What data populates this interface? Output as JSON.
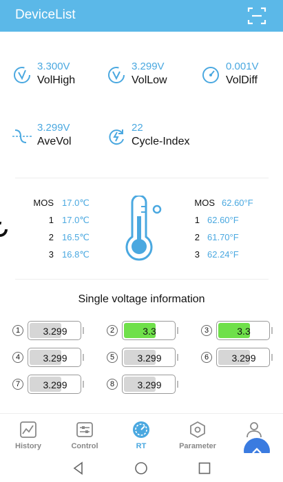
{
  "header": {
    "title": "DeviceList",
    "scan_icon": "scan-icon"
  },
  "stats": [
    {
      "value": "3.300V",
      "label": "VolHigh",
      "icon": "voltage-high-icon"
    },
    {
      "value": "3.299V",
      "label": "VolLow",
      "icon": "voltage-low-icon"
    },
    {
      "value": "0.001V",
      "label": "VolDiff",
      "icon": "gauge-icon"
    },
    {
      "value": "3.299V",
      "label": "AveVol",
      "icon": "average-voltage-icon"
    },
    {
      "value": "22",
      "label": "Cycle-Index",
      "icon": "cycle-icon"
    }
  ],
  "temps_c": [
    {
      "key": "MOS",
      "value": "17.0℃"
    },
    {
      "key": "1",
      "value": "17.0℃"
    },
    {
      "key": "2",
      "value": "16.5℃"
    },
    {
      "key": "3",
      "value": "16.8℃"
    }
  ],
  "temps_f": [
    {
      "key": "MOS",
      "value": "62.60°F"
    },
    {
      "key": "1",
      "value": "62.60°F"
    },
    {
      "key": "2",
      "value": "61.70°F"
    },
    {
      "key": "3",
      "value": "62.24°F"
    }
  ],
  "single_voltage": {
    "title": "Single voltage information",
    "cells": [
      {
        "num": "1",
        "value": "3.299",
        "level": 0.6,
        "highlight": false
      },
      {
        "num": "2",
        "value": "3.3",
        "level": 0.6,
        "highlight": true
      },
      {
        "num": "3",
        "value": "3.3",
        "level": 0.6,
        "highlight": true
      },
      {
        "num": "4",
        "value": "3.299",
        "level": 0.6,
        "highlight": false
      },
      {
        "num": "5",
        "value": "3.299",
        "level": 0.6,
        "highlight": false
      },
      {
        "num": "6",
        "value": "3.299",
        "level": 0.6,
        "highlight": false
      },
      {
        "num": "7",
        "value": "3.299",
        "level": 0.6,
        "highlight": false
      },
      {
        "num": "8",
        "value": "3.299",
        "level": 0.6,
        "highlight": false
      }
    ]
  },
  "nav": [
    {
      "label": "History",
      "icon": "history-chart-icon",
      "active": false
    },
    {
      "label": "Control",
      "icon": "control-sliders-icon",
      "active": false
    },
    {
      "label": "RT",
      "icon": "realtime-gauge-icon",
      "active": true
    },
    {
      "label": "Parameter",
      "icon": "parameter-hex-icon",
      "active": false
    },
    {
      "label": "",
      "icon": "user-icon",
      "active": false
    }
  ],
  "colors": {
    "accent": "#4aa8e0",
    "header": "#5bb8e8",
    "cell_highlight": "#6fe04a",
    "cell_normal": "#d6d6d6",
    "fab": "#3a7be0"
  }
}
